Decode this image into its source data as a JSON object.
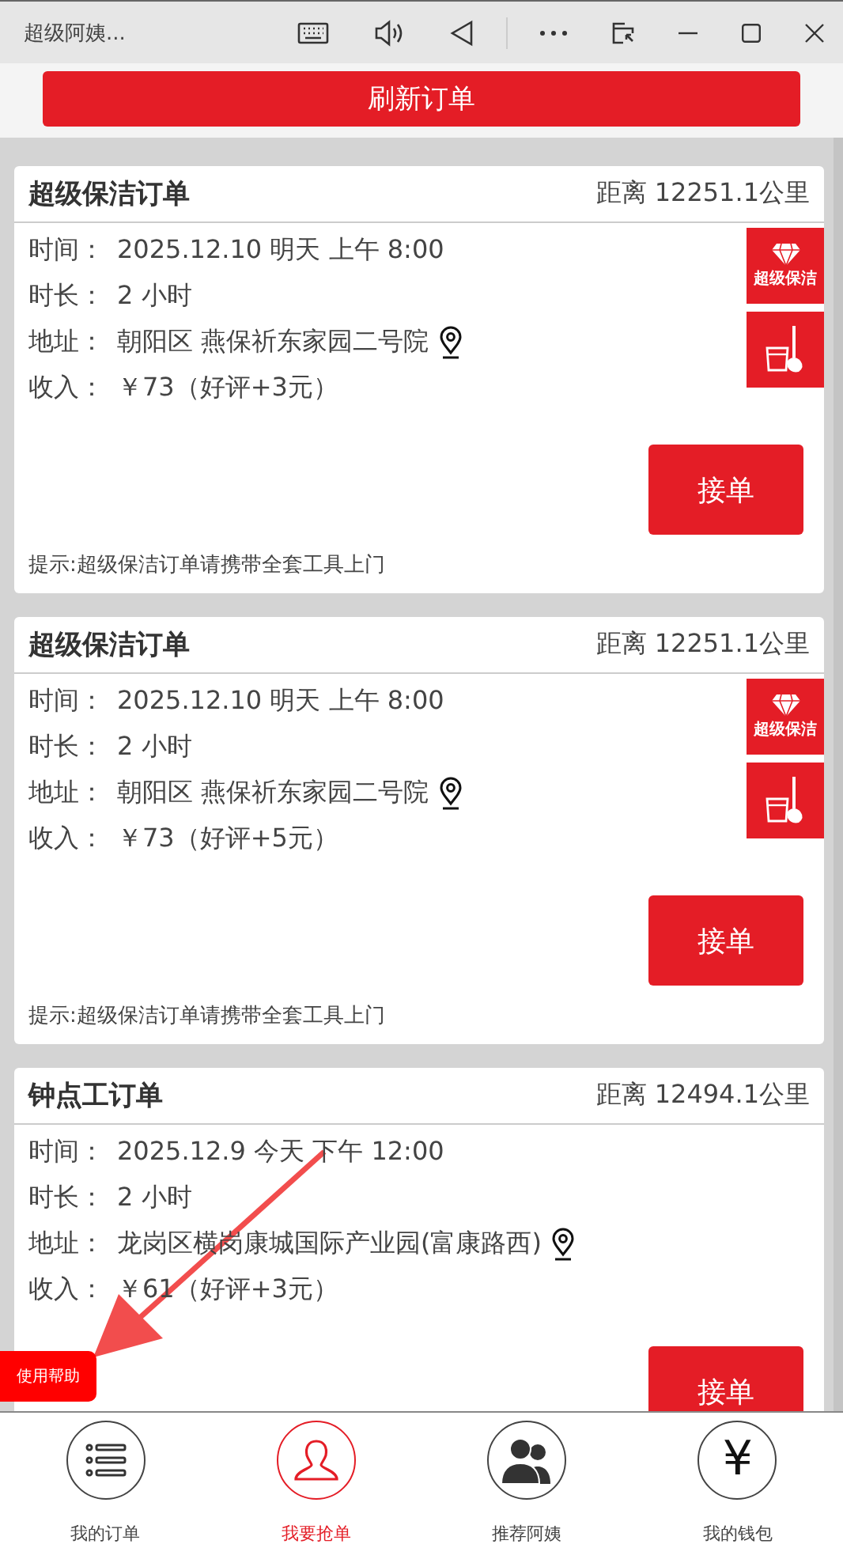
{
  "window": {
    "title": "超级阿姨..."
  },
  "refresh_button": "刷新订单",
  "orders": [
    {
      "title": "超级保洁订单",
      "distance": "距离 12251.1公里",
      "fields": [
        {
          "label": "时间：",
          "value": "2025.12.10 明天 上午 8:00"
        },
        {
          "label": "时长：",
          "value": "2 小时"
        },
        {
          "label": "地址：",
          "value": "朝阳区 燕保祈东家园二号院",
          "kind": "address"
        },
        {
          "label": "收入：",
          "value": "￥73（好评+3元）"
        }
      ],
      "badges": [
        {
          "kind": "diamond",
          "label": "超级保洁"
        },
        {
          "kind": "tools"
        }
      ],
      "accept_button": "接单",
      "tip": "提示:超级保洁订单请携带全套工具上门"
    },
    {
      "title": "超级保洁订单",
      "distance": "距离 12251.1公里",
      "fields": [
        {
          "label": "时间：",
          "value": "2025.12.10 明天 上午 8:00"
        },
        {
          "label": "时长：",
          "value": "2 小时"
        },
        {
          "label": "地址：",
          "value": "朝阳区 燕保祈东家园二号院",
          "kind": "address"
        },
        {
          "label": "收入：",
          "value": "￥73（好评+5元）"
        }
      ],
      "badges": [
        {
          "kind": "diamond",
          "label": "超级保洁"
        },
        {
          "kind": "tools"
        }
      ],
      "accept_button": "接单",
      "tip": "提示:超级保洁订单请携带全套工具上门"
    },
    {
      "title": "钟点工订单",
      "distance": "距离 12494.1公里",
      "fields": [
        {
          "label": "时间：",
          "value": "2025.12.9 今天 下午 12:00"
        },
        {
          "label": "时长：",
          "value": "2 小时"
        },
        {
          "label": "地址：",
          "value": "龙岗区横岗康城国际产业园(富康路西)",
          "kind": "address"
        },
        {
          "label": "收入：",
          "value": "￥61（好评+3元）"
        }
      ],
      "accept_button": "接单"
    }
  ],
  "help_button": "使用帮助",
  "nav": [
    {
      "kind": "list",
      "label": "我的订单",
      "selected": false
    },
    {
      "kind": "person",
      "label": "我要抢单",
      "selected": true
    },
    {
      "kind": "people",
      "label": "推荐阿姨",
      "selected": false
    },
    {
      "kind": "yuan",
      "label": "我的钱包",
      "selected": false,
      "glyph": "¥"
    }
  ]
}
